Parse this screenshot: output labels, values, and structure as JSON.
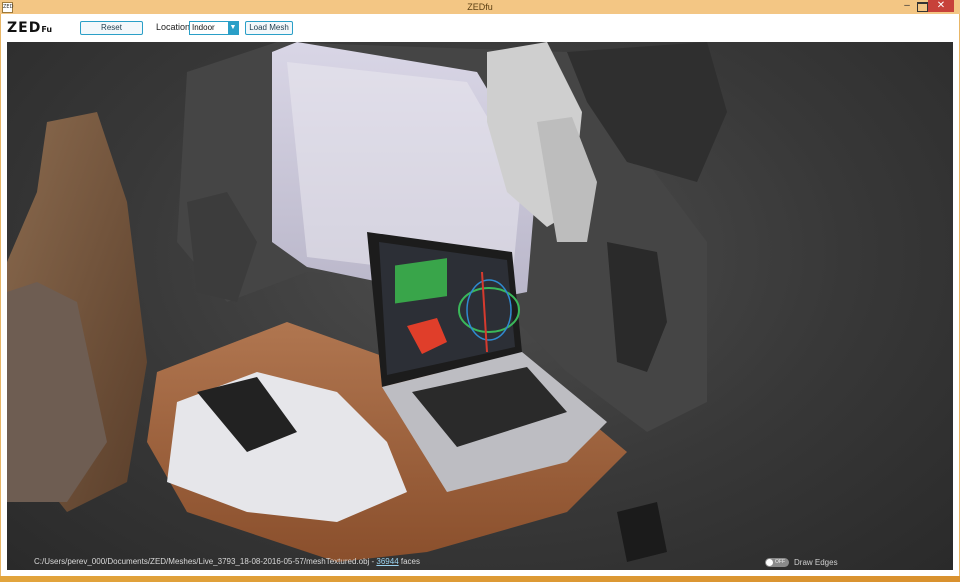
{
  "window": {
    "title": "ZEDfu",
    "icon": "app-icon",
    "min_label": "–",
    "close_label": "✕"
  },
  "toolbar": {
    "logo_main": "ZED",
    "logo_sub": "Fu",
    "reset_label": "Reset",
    "location_label": "Location",
    "location_value": "Indoor",
    "load_label": "Load Mesh"
  },
  "status": {
    "path": "C:/Users/perev_000/Documents/ZED/Meshes/Live_3793_18-08-2016-05-57/meshTextured.obj - ",
    "faces_count": "36944",
    "faces_suffix": " faces"
  },
  "edges": {
    "switch_state": "OFF",
    "label": "Draw Edges"
  },
  "colors": {
    "accent": "#2a9fc7",
    "title_bar": "#f3c684",
    "close": "#c7413a",
    "viewport_bg": "#3a3a3a"
  },
  "viewport": {
    "content": "textured-3d-mesh-render"
  }
}
